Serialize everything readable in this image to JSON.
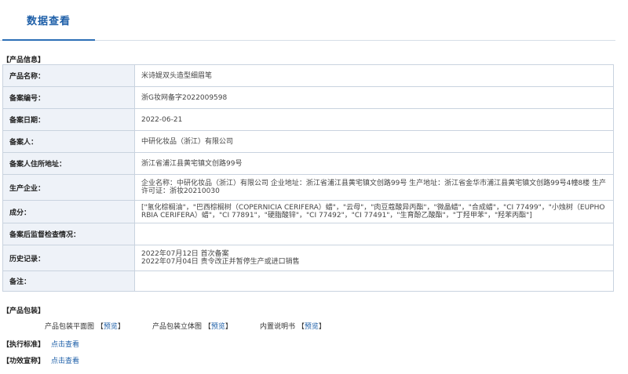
{
  "tabs": [
    {
      "label": "数据查看"
    }
  ],
  "product_info": {
    "section_title": "【产品信息】",
    "rows": [
      {
        "label": "产品名称：",
        "value": "米诗媞双头造型细眉笔"
      },
      {
        "label": "备案编号：",
        "value": "浙G妆网备字2022009598"
      },
      {
        "label": "备案日期：",
        "value": "2022-06-21"
      },
      {
        "label": "备案人：",
        "value": "中研化妆品（浙江）有限公司"
      },
      {
        "label": "备案人住所地址：",
        "value": "浙江省浦江县黄宅镇文创路99号"
      },
      {
        "label": "生产企业：",
        "value": "企业名称：中研化妆品（浙江）有限公司 企业地址：浙江省浦江县黄宅镇文创路99号 生产地址：浙江省金华市浦江县黄宅镇文创路99号4幢8楼 生产许可证：浙妆20210030"
      },
      {
        "label": "成分：",
        "value": "[\"氢化棕榈油\"，\"巴西棕榈树（COPERNICIA CERIFERA）蜡\"，\"云母\"，\"肉豆蔻酸异丙酯\"，\"微晶蜡\"，\"合成蜡\"，\"CI 77499\"，\"小烛树（EUPHORBIA CERIFERA）蜡\"，\"CI 77891\"，\"硬脂酸锌\"，\"CI 77492\"，\"CI 77491\"，\"生育酚乙酸酯\"，\"丁羟甲苯\"，\"羟苯丙酯\"]"
      },
      {
        "label": "备案后监督检查情况：",
        "value": ""
      },
      {
        "label": "历史记录：",
        "value_lines": [
          "2022年07月12日 首次备案",
          "2022年07月04日 责令改正并暂停生产或进口销售"
        ]
      },
      {
        "label": "备注：",
        "value": ""
      }
    ]
  },
  "packaging": {
    "section_title": "【产品包装】",
    "items": [
      {
        "label": "产品包装平面图",
        "link": "预览"
      },
      {
        "label": "产品包装立体图",
        "link": "预览"
      },
      {
        "label": "内置说明书",
        "link": "预览"
      }
    ]
  },
  "standard": {
    "section_title": "【执行标准】",
    "link": "点击查看"
  },
  "efficacy": {
    "section_title": "【功效宣称】",
    "link": "点击查看"
  }
}
